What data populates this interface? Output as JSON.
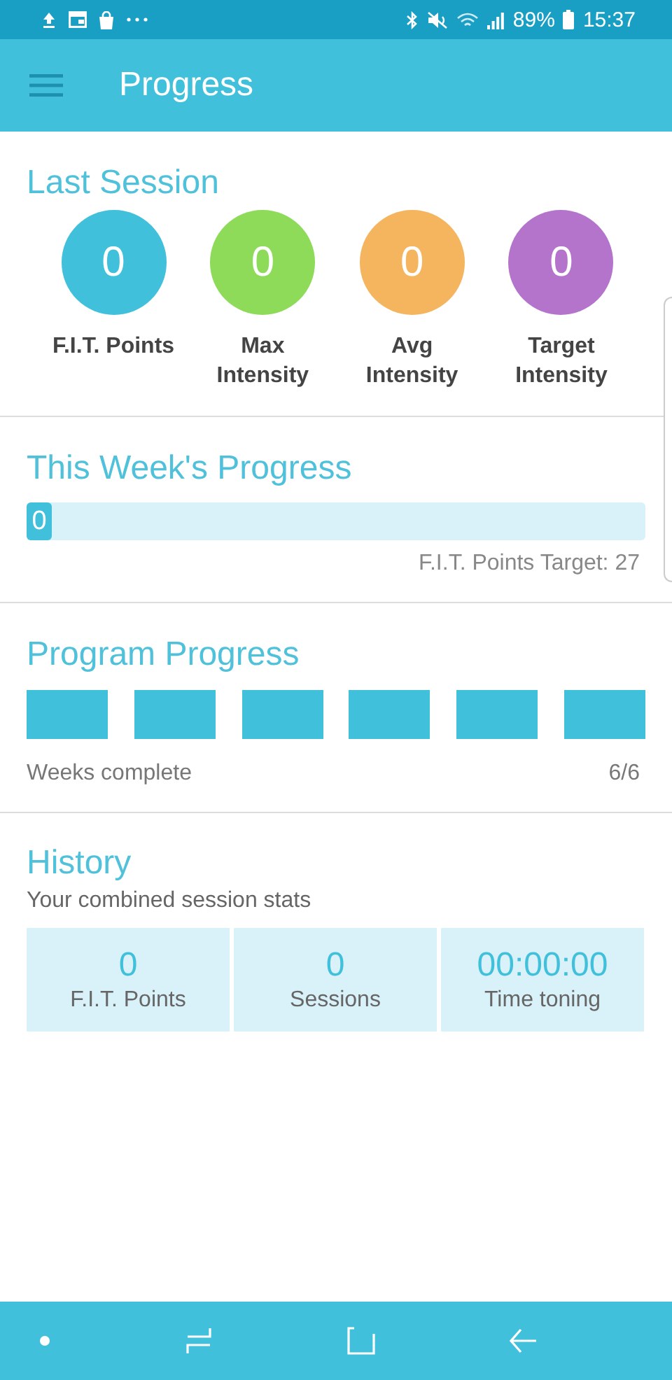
{
  "status_bar": {
    "battery": "89%",
    "time": "15:37"
  },
  "app_bar": {
    "title": "Progress"
  },
  "last_session": {
    "title": "Last Session",
    "stats": [
      {
        "value": "0",
        "label": "F.I.T. Points",
        "color": "#40c0db"
      },
      {
        "value": "0",
        "label": "Max Intensity",
        "color": "#8edb5a"
      },
      {
        "value": "0",
        "label": "Avg Intensity",
        "color": "#f5b55f"
      },
      {
        "value": "0",
        "label": "Target Intensity",
        "color": "#b574cc"
      }
    ]
  },
  "week_progress": {
    "title": "This Week's Progress",
    "value": "0",
    "level": 0,
    "target": "F.I.T. Points Target: 27"
  },
  "program_progress": {
    "title": "Program Progress",
    "weeks": [
      {
        "complete": true
      },
      {
        "complete": true
      },
      {
        "complete": true
      },
      {
        "complete": true
      },
      {
        "complete": true
      },
      {
        "complete": true
      }
    ],
    "label": "Weeks complete",
    "count": "6/6"
  },
  "history": {
    "title": "History",
    "subtitle": "Your combined session stats",
    "tiles": [
      {
        "value": "0",
        "label": "F.I.T. Points"
      },
      {
        "value": "0",
        "label": "Sessions"
      },
      {
        "value": "00:00:00",
        "label": "Time toning"
      }
    ]
  }
}
